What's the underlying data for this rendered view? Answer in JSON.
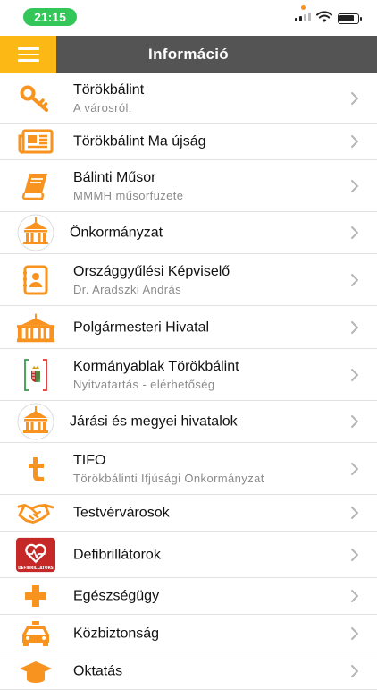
{
  "status_bar": {
    "time": "21:15"
  },
  "header": {
    "title": "Információ"
  },
  "colors": {
    "accent": "#F7931E",
    "header_bg": "#545454",
    "menu_bg": "#FCB815"
  },
  "items": [
    {
      "title": "Törökbálint",
      "subtitle": "A városról.",
      "icon": "key-icon"
    },
    {
      "title": "Törökbálint Ma újság",
      "subtitle": "",
      "icon": "newspaper-icon"
    },
    {
      "title": "Bálinti Műsor",
      "subtitle": "MMMH műsorfüzete",
      "icon": "book-icon"
    },
    {
      "title": "Önkormányzat",
      "subtitle": "",
      "icon": "town-hall-circle-icon"
    },
    {
      "title": "Országgyűlési Képviselő",
      "subtitle": "Dr. Aradszki András",
      "icon": "contact-book-icon"
    },
    {
      "title": "Polgármesteri Hivatal",
      "subtitle": "",
      "icon": "town-hall-icon"
    },
    {
      "title": "Kormányablak Törökbálint",
      "subtitle": "Nyitvatartás - elérhetőség",
      "icon": "government-window-icon"
    },
    {
      "title": "Járási és megyei hivatalok",
      "subtitle": "",
      "icon": "town-hall-circle-icon"
    },
    {
      "title": "TIFO",
      "subtitle": "Törökbálinti Ifjúsági Önkormányzat",
      "icon": "tifo-t-icon"
    },
    {
      "title": "Testvérvárosok",
      "subtitle": "",
      "icon": "handshake-icon"
    },
    {
      "title": "Defibrillátorok",
      "subtitle": "",
      "icon": "defibrillator-icon",
      "icon_label": "DEFIBRILLATORS"
    },
    {
      "title": "Egészségügy",
      "subtitle": "",
      "icon": "medical-cross-icon"
    },
    {
      "title": "Közbiztonság",
      "subtitle": "",
      "icon": "police-car-icon"
    },
    {
      "title": "Oktatás",
      "subtitle": "",
      "icon": "graduation-cap-icon"
    }
  ]
}
